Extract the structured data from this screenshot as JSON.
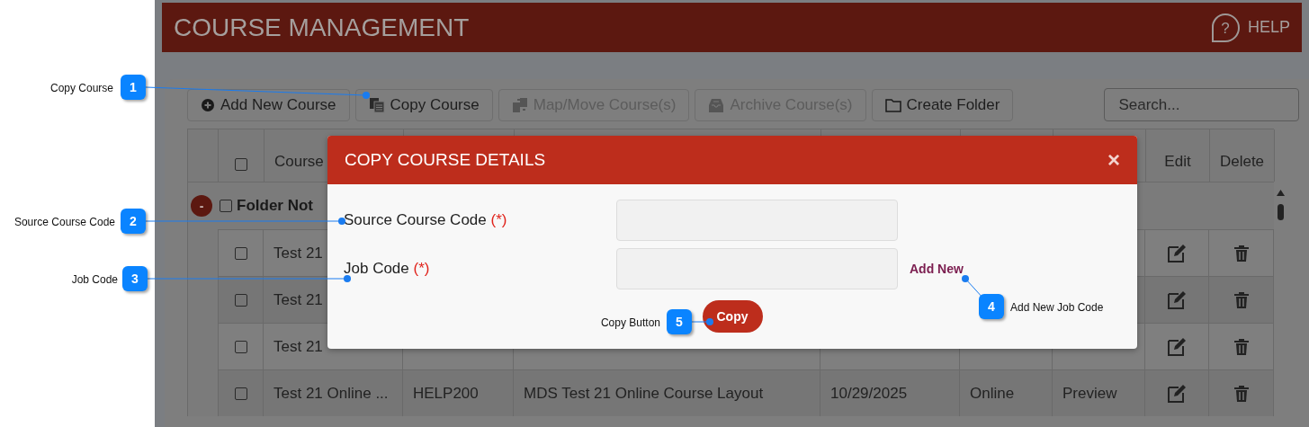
{
  "header": {
    "title": "COURSE MANAGEMENT",
    "help_icon": "?",
    "help": "HELP"
  },
  "toolbar": {
    "buttons": [
      {
        "kind": "add",
        "label": "Add New Course",
        "disabled": false
      },
      {
        "kind": "copy",
        "label": "Copy Course",
        "disabled": false
      },
      {
        "kind": "map",
        "label": "Map/Move Course(s)",
        "disabled": true
      },
      {
        "kind": "archive",
        "label": "Archive Course(s)",
        "disabled": true
      },
      {
        "kind": "folder",
        "label": "Create Folder",
        "disabled": false
      }
    ],
    "search": {
      "placeholder": "Search..."
    }
  },
  "table": {
    "header": {
      "checked": false,
      "column_3": "Course",
      "edit": "Edit",
      "delete": "Delete"
    },
    "folder": {
      "toggle": "-",
      "checked": false,
      "label": "Folder Not"
    },
    "rows": [
      {
        "checked": false,
        "cells": [
          "Test 21"
        ]
      },
      {
        "checked": false,
        "cells": [
          "Test 21"
        ]
      },
      {
        "checked": false,
        "cells": [
          "Test 21"
        ]
      },
      {
        "checked": false,
        "cells": [
          "Test 21 Online ...",
          "HELP200",
          "MDS Test 21 Online Course Layout",
          "10/29/2025",
          "Online",
          "Preview"
        ]
      }
    ]
  },
  "dialog": {
    "title": "COPY COURSE DETAILS",
    "close": "×",
    "fields": [
      {
        "label": "Source Course Code",
        "required": "(*)"
      },
      {
        "label": "Job Code",
        "required": "(*)",
        "link": "Add New"
      }
    ],
    "button": "Copy"
  },
  "callouts": [
    {
      "number": "1",
      "label": "Copy Course"
    },
    {
      "number": "2",
      "label": "Source Course Code"
    },
    {
      "number": "3",
      "label": "Job Code"
    },
    {
      "number": "4",
      "label": "Add New Job Code"
    },
    {
      "number": "5",
      "label": "Copy Button"
    }
  ]
}
